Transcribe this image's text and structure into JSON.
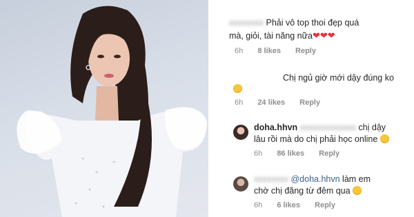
{
  "comments": [
    {
      "line1": "Phải vô top thoi đẹp quá",
      "line2": "mà, giỏi, tài năng nữa",
      "hearts": [
        "❤",
        "❤",
        "❤"
      ],
      "time": "6h",
      "likes": "8 likes",
      "reply": "Reply"
    },
    {
      "line1": "Chị ngủ giờ mới dậy đúng ko",
      "emoji": "laughing-tears-emoji",
      "time": "6h",
      "likes": "24 likes",
      "reply": "Reply"
    },
    {
      "username": "doha.hhvn",
      "line1_end": "chị dậy",
      "line2": "lâu rồi mà do chị phải học online",
      "emoji": "sad-emoji",
      "time": "6h",
      "likes": "86 likes",
      "reply": "Reply"
    },
    {
      "mention": "@doha.hhvn",
      "line1_end": "làm em",
      "line2": "chờ chị đăng từ đêm qua",
      "emoji": "smiling-hearts-emoji",
      "time": "6h",
      "likes": "6 likes",
      "reply": "Reply"
    }
  ],
  "colors": {
    "text": "#262626",
    "meta": "#8e8e8e",
    "mention": "#3b5f8c",
    "heart": "#ed2f3d"
  }
}
